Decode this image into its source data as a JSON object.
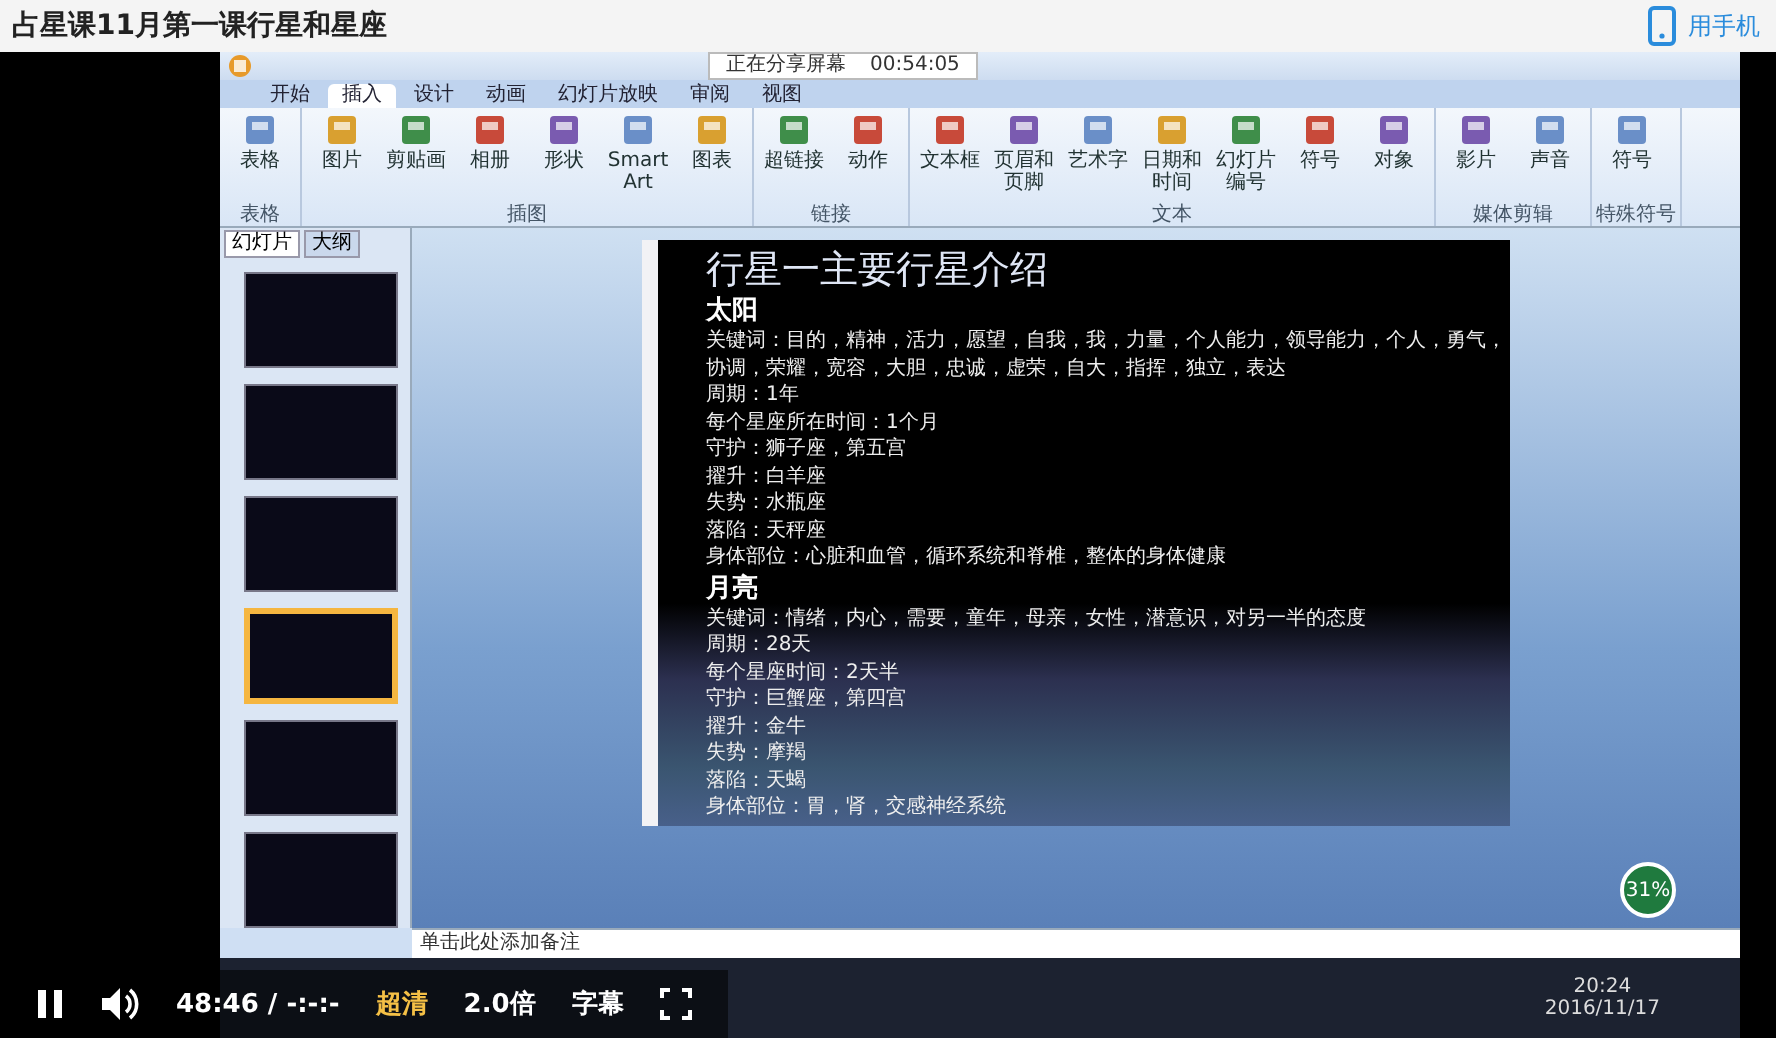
{
  "page_title": "占星课11月第一课行星和星座",
  "mobile_link": "用手机",
  "recording": {
    "share_status": "正在分享屏幕",
    "share_time": "00:54:05",
    "ribbon_tabs": [
      {
        "label": "开始",
        "selected": false
      },
      {
        "label": "插入",
        "selected": true
      },
      {
        "label": "设计",
        "selected": false
      },
      {
        "label": "动画",
        "selected": false
      },
      {
        "label": "幻灯片放映",
        "selected": false
      },
      {
        "label": "审阅",
        "selected": false
      },
      {
        "label": "视图",
        "selected": false
      }
    ],
    "ribbon_groups": [
      {
        "label": "表格",
        "items": [
          "表格"
        ]
      },
      {
        "label": "插图",
        "items": [
          "图片",
          "剪贴画",
          "相册",
          "形状",
          "SmartArt",
          "图表"
        ]
      },
      {
        "label": "链接",
        "items": [
          "超链接",
          "动作"
        ]
      },
      {
        "label": "文本",
        "items": [
          "文本框",
          "页眉和页脚",
          "艺术字",
          "日期和时间",
          "幻灯片编号",
          "符号",
          "对象"
        ]
      },
      {
        "label": "媒体剪辑",
        "items": [
          "影片",
          "声音"
        ]
      },
      {
        "label": "特殊符号",
        "items": [
          "符号"
        ]
      }
    ],
    "panel_tabs": [
      {
        "label": "幻灯片",
        "selected": true
      },
      {
        "label": "大纲",
        "selected": false
      }
    ],
    "thumbnails": [
      {
        "selected": false
      },
      {
        "selected": false
      },
      {
        "selected": false
      },
      {
        "selected": true
      },
      {
        "selected": false
      },
      {
        "selected": false
      }
    ],
    "slide": {
      "title": "行星一主要行星介绍",
      "sections": [
        {
          "heading": "太阳",
          "lines": [
            "关键词：目的，精神，活力，愿望，自我，我，力量，个人能力，领导能力，个人，勇气，",
            "协调，荣耀，宽容，大胆，忠诚，虚荣，自大，指挥，独立，表达",
            "周期：1年",
            "每个星座所在时间：1个月",
            "守护：狮子座，第五宫",
            "擢升：白羊座",
            "失势：水瓶座",
            "落陷：天秤座",
            "身体部位：心脏和血管，循环系统和脊椎，整体的身体健康"
          ]
        },
        {
          "heading": "月亮",
          "lines": [
            "关键词：情绪，内心，需要，童年，母亲，女性，潜意识，对另一半的态度",
            "周期：28天",
            "每个星座时间：2天半",
            "守护：巨蟹座，第四宫",
            "擢升：金牛",
            "失势：摩羯",
            "落陷：天蝎",
            "身体部位：胃，肾，交感神经系统"
          ]
        }
      ]
    },
    "notes_placeholder": "单击此处添加备注",
    "net_meter": "31%",
    "clock": {
      "time": "20:24",
      "date": "2016/11/17"
    }
  },
  "player": {
    "playing": true,
    "position": "48:46",
    "separator": "/",
    "duration": "-:-:-",
    "options": [
      {
        "label": "超清",
        "selected": true
      },
      {
        "label": "2.0倍",
        "selected": false
      },
      {
        "label": "字幕",
        "selected": false
      }
    ]
  }
}
